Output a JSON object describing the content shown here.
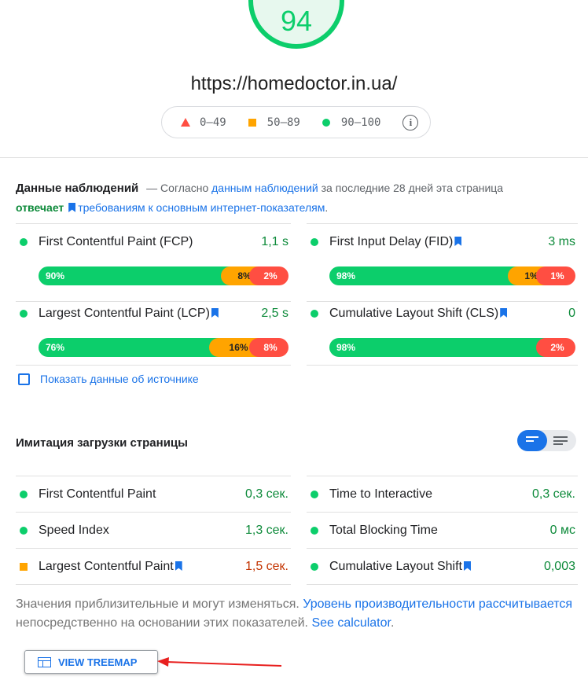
{
  "gauge": {
    "score": "94",
    "color": "#0cce6b"
  },
  "url": "https://homedoctor.in.ua/",
  "legend": {
    "fail": "0–49",
    "average": "50–89",
    "pass": "90–100",
    "info_icon": "info-icon"
  },
  "field": {
    "title": "Данные наблюдений",
    "desc_prefix": "— Согласно",
    "desc_link": "данным наблюдений",
    "desc_mid": "за последние 28 дней эта страница",
    "status": "отвечает",
    "req_link": "требованиям к основным интернет-показателям",
    "desc_end": ".",
    "metrics": [
      {
        "name": "First Contentful Paint (FCP)",
        "value": "1,1 s",
        "core": false,
        "good": "90%",
        "ni": "8%",
        "poor": "2%",
        "good_pct": 90,
        "ni_pct": 8,
        "poor_pct": 2
      },
      {
        "name": "First Input Delay (FID)",
        "value": "3 ms",
        "core": true,
        "good": "98%",
        "ni": "1%",
        "poor": "1%",
        "good_pct": 98,
        "ni_pct": 1,
        "poor_pct": 1
      },
      {
        "name": "Largest Contentful Paint (LCP)",
        "value": "2,5 s",
        "core": true,
        "good": "76%",
        "ni": "16%",
        "poor": "8%",
        "good_pct": 76,
        "ni_pct": 16,
        "poor_pct": 8
      },
      {
        "name": "Cumulative Layout Shift (CLS)",
        "value": "0",
        "core": true,
        "good": "98%",
        "ni": "",
        "poor": "2%",
        "good_pct": 98,
        "ni_pct": 0,
        "poor_pct": 2
      }
    ],
    "show_source": "Показать данные об источнике"
  },
  "lab": {
    "title": "Имитация загрузки страницы",
    "metrics": [
      {
        "name": "First Contentful Paint",
        "value": "0,3 сек.",
        "rating": "pass",
        "core": false
      },
      {
        "name": "Time to Interactive",
        "value": "0,3 сек.",
        "rating": "pass",
        "core": false
      },
      {
        "name": "Speed Index",
        "value": "1,3 сек.",
        "rating": "pass",
        "core": false
      },
      {
        "name": "Total Blocking Time",
        "value": "0 мс",
        "rating": "pass",
        "core": false
      },
      {
        "name": "Largest Contentful Paint",
        "value": "1,5 сек.",
        "rating": "average",
        "core": true
      },
      {
        "name": "Cumulative Layout Shift",
        "value": "0,003",
        "rating": "pass",
        "core": true
      }
    ]
  },
  "note": {
    "prefix": "Значения приблизительные и могут изменяться.",
    "link1": "Уровень производительности рассчитывается",
    "mid": "непосредственно на основании этих показателей.",
    "link2": "See calculator",
    "end": "."
  },
  "treemap_button": "VIEW TREEMAP",
  "colors": {
    "pass": "#0cce6b",
    "average": "#ffa400",
    "fail": "#ff4e42",
    "link": "#1a73e8",
    "annotation_arrow": "#e8201f"
  }
}
